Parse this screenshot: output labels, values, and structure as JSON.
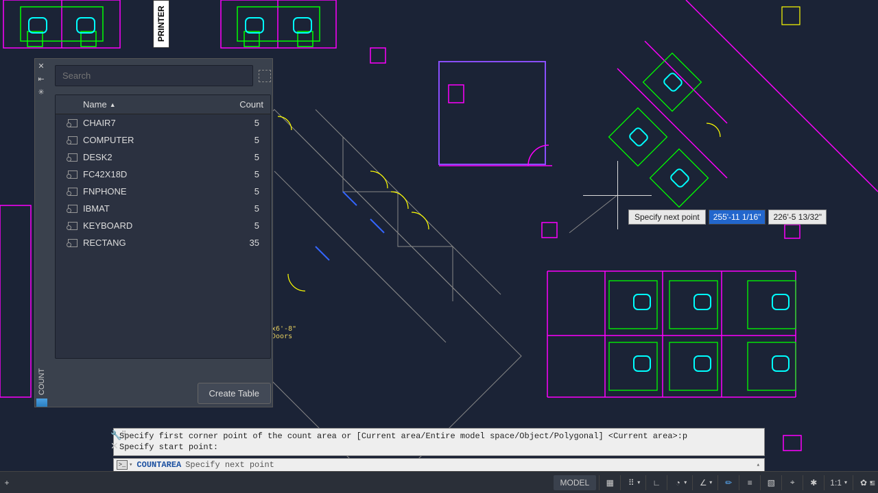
{
  "palette": {
    "title": "COUNT",
    "search_placeholder": "Search",
    "headers": {
      "name": "Name",
      "count": "Count"
    },
    "rows": [
      {
        "name": "CHAIR7",
        "count": "5"
      },
      {
        "name": "COMPUTER",
        "count": "5"
      },
      {
        "name": "DESK2",
        "count": "5"
      },
      {
        "name": "FC42X18D",
        "count": "5"
      },
      {
        "name": "FNPHONE",
        "count": "5"
      },
      {
        "name": "IBMAT",
        "count": "5"
      },
      {
        "name": "KEYBOARD",
        "count": "5"
      },
      {
        "name": "RECTANG",
        "count": "35"
      }
    ],
    "create_table": "Create Table"
  },
  "printer_label": "PRINTER",
  "dynamic": {
    "label": "Specify next point",
    "x": "255'-11 1/16\"",
    "y": "226'-5 13/32\""
  },
  "cmd": {
    "history_line1": "Specify first corner point of the count area or [Current area/Entire model space/Object/Polygonal] <Current area>:p",
    "history_line2": "Specify start point:",
    "command": "COUNTAREA",
    "prompt": "Specify next point"
  },
  "statusbar": {
    "model": "MODEL",
    "ratio": "1:1"
  },
  "annotations": {
    "doors": "x6'-8\"\nDoors"
  }
}
